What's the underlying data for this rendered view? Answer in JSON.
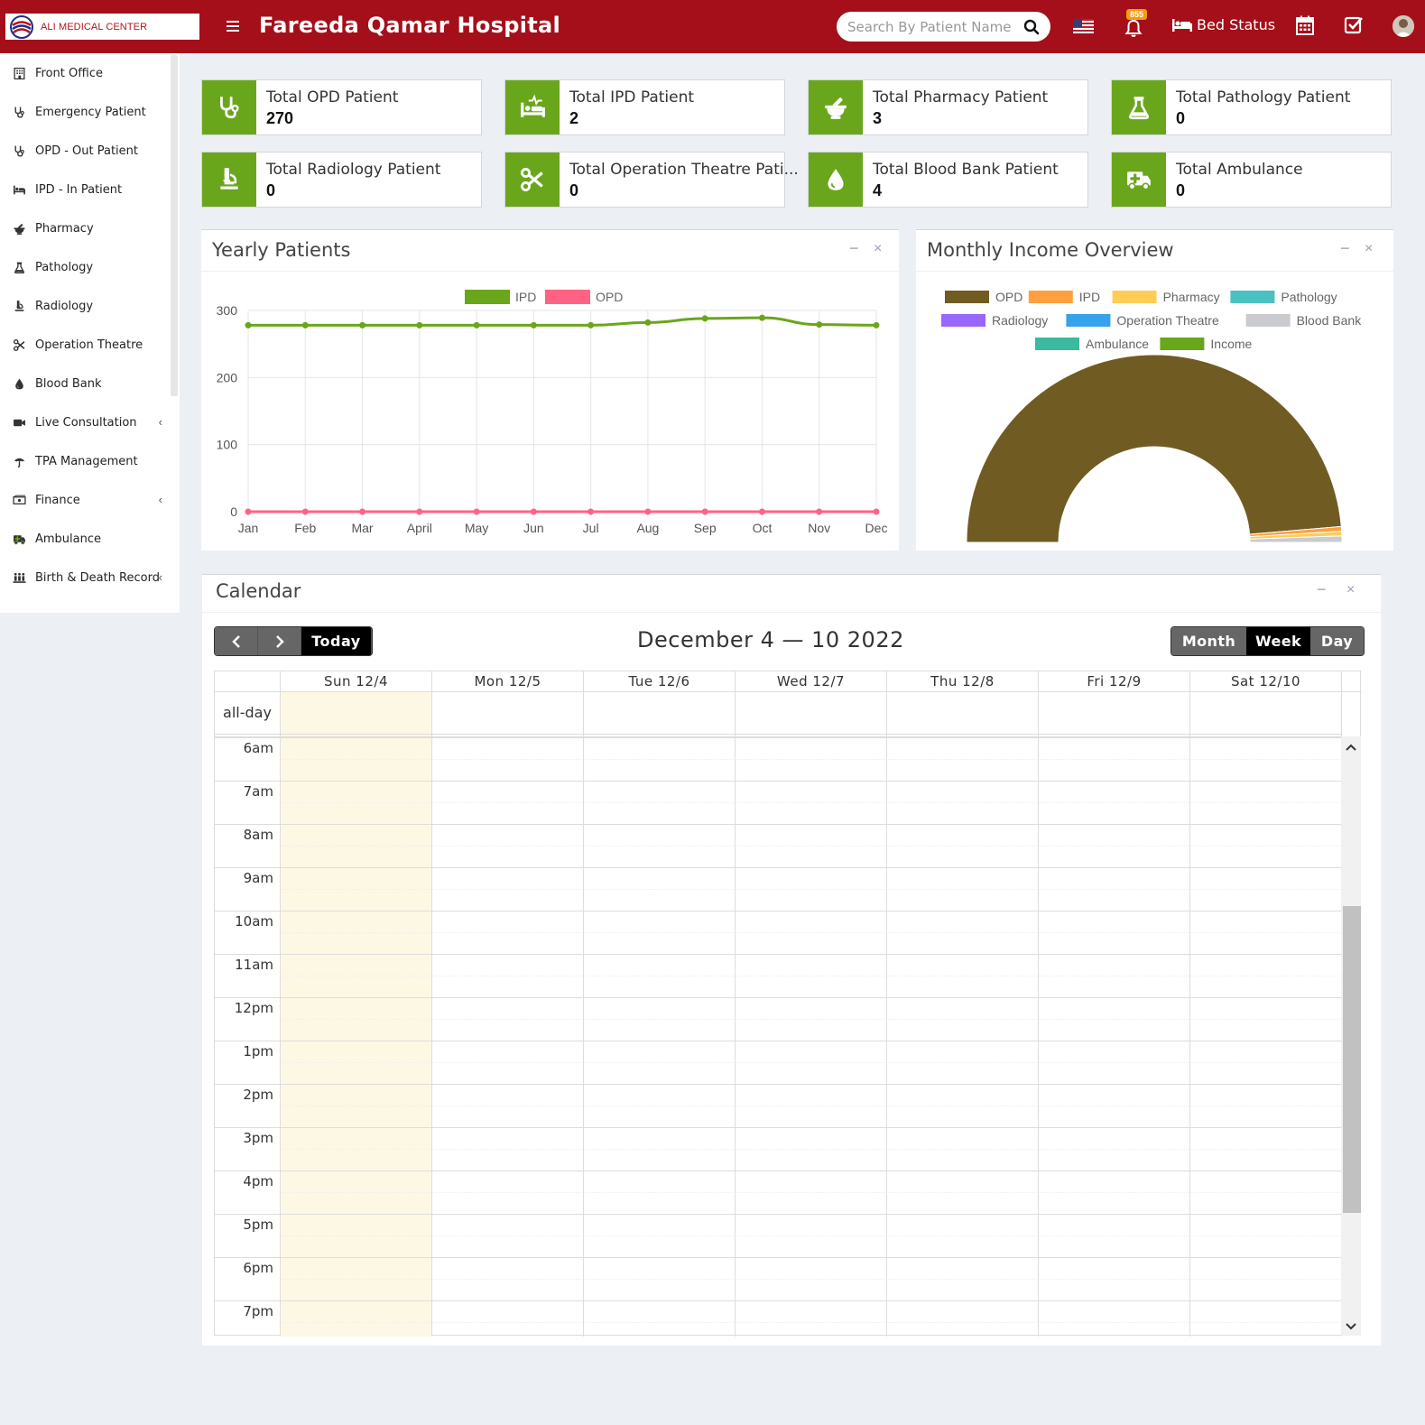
{
  "header": {
    "logo_text": "ALI MEDICAL CENTER",
    "title": "Fareeda Qamar Hospital",
    "search_placeholder": "Search By Patient Name",
    "notification_count": "855",
    "bed_status_label": "Bed Status",
    "brand_color": "#a50f1a"
  },
  "sidebar": {
    "items": [
      {
        "label": "Front Office",
        "icon": "building-icon"
      },
      {
        "label": "Emergency Patient",
        "icon": "stethoscope-icon"
      },
      {
        "label": "OPD - Out Patient",
        "icon": "stethoscope-icon"
      },
      {
        "label": "IPD - In Patient",
        "icon": "bed-icon"
      },
      {
        "label": "Pharmacy",
        "icon": "mortar-pestle-icon"
      },
      {
        "label": "Pathology",
        "icon": "flask-icon"
      },
      {
        "label": "Radiology",
        "icon": "microscope-icon"
      },
      {
        "label": "Operation Theatre",
        "icon": "scissors-icon"
      },
      {
        "label": "Blood Bank",
        "icon": "drop-icon"
      },
      {
        "label": "Live Consultation",
        "icon": "video-icon"
      },
      {
        "label": "TPA Management",
        "icon": "umbrella-icon"
      },
      {
        "label": "Finance",
        "icon": "money-icon"
      },
      {
        "label": "Ambulance",
        "icon": "ambulance-icon"
      },
      {
        "label": "Birth & Death Record",
        "icon": "family-icon"
      }
    ]
  },
  "stats": [
    {
      "label": "Total OPD Patient",
      "value": "270",
      "icon": "stethoscope-icon"
    },
    {
      "label": "Total IPD Patient",
      "value": "2",
      "icon": "procedures-icon"
    },
    {
      "label": "Total Pharmacy Patient",
      "value": "3",
      "icon": "mortar-pestle-icon"
    },
    {
      "label": "Total Pathology Patient",
      "value": "0",
      "icon": "flask-icon"
    },
    {
      "label": "Total Radiology Patient",
      "value": "0",
      "icon": "microscope-icon"
    },
    {
      "label": "Total Operation Theatre Pati...",
      "value": "0",
      "icon": "scissors-icon"
    },
    {
      "label": "Total Blood Bank Patient",
      "value": "4",
      "icon": "drop-icon"
    },
    {
      "label": "Total Ambulance",
      "value": "0",
      "icon": "ambulance-icon"
    }
  ],
  "stat_color": "#6aa61b",
  "yearly": {
    "title": "Yearly Patients",
    "minimize": "−",
    "close": "×"
  },
  "monthly": {
    "title": "Monthly Income Overview",
    "minimize": "−",
    "close": "×"
  },
  "chart_data": [
    {
      "type": "line",
      "title": "Yearly Patients",
      "x": [
        "Jan",
        "Feb",
        "Mar",
        "April",
        "May",
        "Jun",
        "Jul",
        "Aug",
        "Sep",
        "Oct",
        "Nov",
        "Dec"
      ],
      "ylim": [
        0,
        300
      ],
      "yticks": [
        0,
        100,
        200,
        300
      ],
      "legend_position": "top",
      "grid": true,
      "series": [
        {
          "name": "IPD",
          "color": "#6aa61b",
          "values": [
            278,
            278,
            278,
            278,
            278,
            278,
            278,
            282,
            288,
            289,
            279,
            278
          ]
        },
        {
          "name": "OPD",
          "color": "#ff6384",
          "values": [
            0,
            0,
            0,
            0,
            0,
            0,
            0,
            0,
            0,
            0,
            0,
            0
          ]
        }
      ]
    },
    {
      "type": "pie",
      "variant": "half-doughnut",
      "title": "Monthly Income Overview",
      "legend_position": "top",
      "labels": [
        "OPD",
        "IPD",
        "Pharmacy",
        "Pathology",
        "Radiology",
        "Operation Theatre",
        "Blood Bank",
        "Ambulance",
        "Income"
      ],
      "colors": [
        "#705c22",
        "#ff9f40",
        "#ffcd56",
        "#4bc0c0",
        "#9966ff",
        "#36a2eb",
        "#c9cbcf",
        "#3cba9f",
        "#6aa61b"
      ],
      "values": [
        97.3,
        0.8,
        0.8,
        0,
        0,
        0,
        1.1,
        0,
        0
      ]
    }
  ],
  "calendar": {
    "title": "Calendar",
    "minimize": "−",
    "close": "×",
    "prev": "<",
    "next": ">",
    "today": "Today",
    "range": "December 4 — 10 2022",
    "views": [
      "Month",
      "Week",
      "Day"
    ],
    "active_view": "Week",
    "days": [
      "Sun 12/4",
      "Mon 12/5",
      "Tue 12/6",
      "Wed 12/7",
      "Thu 12/8",
      "Fri 12/9",
      "Sat 12/10"
    ],
    "today_index": 0,
    "today_color": "#fcf8e3",
    "allday_label": "all-day",
    "times": [
      "6am",
      "7am",
      "8am",
      "9am",
      "10am",
      "11am",
      "12pm",
      "1pm",
      "2pm",
      "3pm",
      "4pm",
      "5pm",
      "6pm",
      "7pm"
    ]
  }
}
